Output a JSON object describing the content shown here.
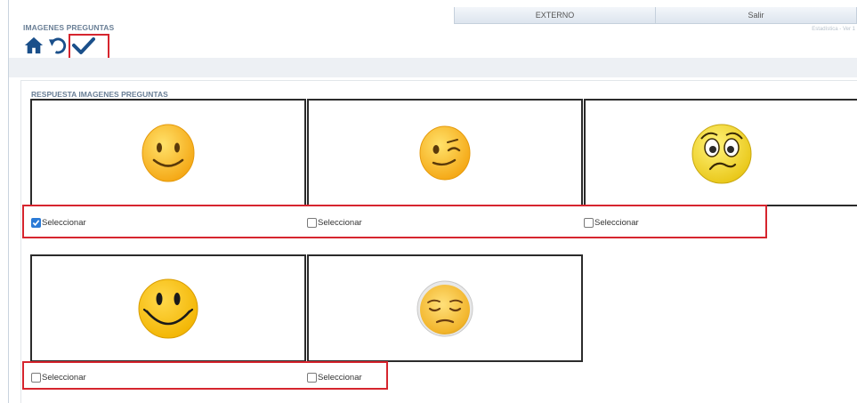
{
  "tabs": [
    "EXTERNO",
    "Salir"
  ],
  "page_title": "IMAGENES PREGUNTAS",
  "version_text": "Estadística - Ver 1",
  "toolbar": {
    "home_icon": "home-icon",
    "undo_icon": "undo-icon",
    "confirm_icon": "check-icon",
    "icon_color": "#1a4f8a"
  },
  "section_title": "RESPUESTA IMAGENES PREGUNTAS",
  "options": [
    {
      "image": "smiling-face",
      "label": "Seleccionar",
      "checked": true
    },
    {
      "image": "winking-face",
      "label": "Seleccionar",
      "checked": false
    },
    {
      "image": "worried-face",
      "label": "Seleccionar",
      "checked": false
    },
    {
      "image": "big-grin-face",
      "label": "Seleccionar",
      "checked": false
    },
    {
      "image": "pensive-face",
      "label": "Seleccionar",
      "checked": false
    }
  ],
  "colors": {
    "highlight": "#d6252e",
    "checkbox_checked": "#2a7ad6"
  }
}
